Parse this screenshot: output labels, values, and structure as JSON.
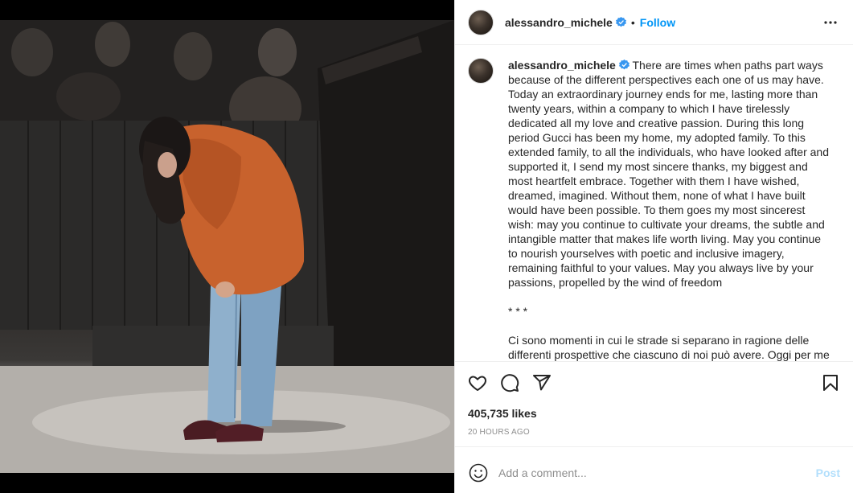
{
  "post": {
    "username": "alessandro_michele",
    "follow_label": "Follow",
    "separator": "•",
    "caption_username": "alessandro_michele",
    "caption_text": " There are times when paths part ways because of the different perspectives each one of us may have. Today an extraordinary journey ends for me, lasting more than twenty years, within a company to which I have tirelessly dedicated all my love and creative passion. During this long period Gucci has been my home, my adopted family. To this extended family, to all the individuals, who have looked after and supported it, I send my most sincere thanks, my biggest and most heartfelt embrace. Together with them I have wished, dreamed, imagined. Without them, none of what I have built would have been possible. To them goes my most sincerest wish: may you continue to cultivate your dreams, the subtle and intangible matter that makes life worth living. May you continue to nourish yourselves with poetic and inclusive imagery, remaining faithful to your values. May you always live by your passions, propelled by the wind of freedom\n\n* * *\n\nCi sono momenti in cui le strade si separano in ragione delle differenti prospettive che ciascuno di noi può avere. Oggi per me",
    "likes": "405,735 likes",
    "time": "20 HOURS AGO",
    "comment_placeholder": "Add a comment...",
    "post_label": "Post"
  },
  "icons": {
    "verified": "verified-badge-icon",
    "more": "more-options-icon",
    "like": "heart-icon",
    "comment": "comment-bubble-icon",
    "share": "paper-plane-icon",
    "save": "bookmark-icon",
    "emoji": "emoji-smiley-icon"
  },
  "colors": {
    "accent": "#0095f6",
    "verified": "#3897f0",
    "post_disabled": "#b2dffc",
    "muted": "#8e8e8e"
  }
}
